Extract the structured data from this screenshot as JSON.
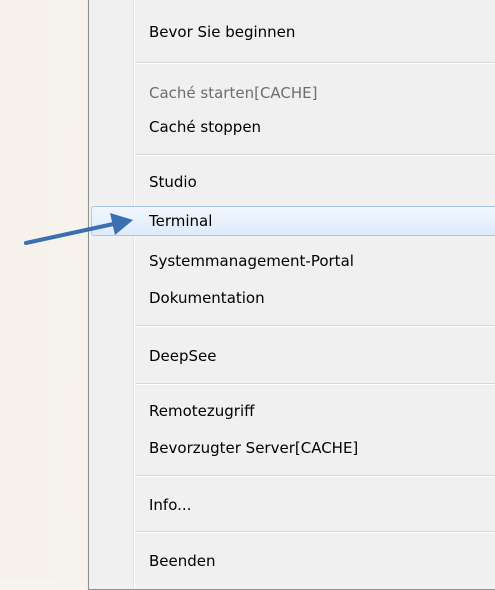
{
  "menu": {
    "items": [
      {
        "label": "Bevor Sie beginnen"
      },
      {
        "label": "Caché starten[CACHE]"
      },
      {
        "label": "Caché stoppen"
      },
      {
        "label": "Studio"
      },
      {
        "label": "Terminal"
      },
      {
        "label": "Systemmanagement-Portal"
      },
      {
        "label": "Dokumentation"
      },
      {
        "label": "DeepSee"
      },
      {
        "label": "Remotezugriff"
      },
      {
        "label": "Bevorzugter Server[CACHE]"
      },
      {
        "label": "Info..."
      },
      {
        "label": "Beenden"
      }
    ]
  },
  "annotation": {
    "color": "#3a6fb0",
    "icon": "arrow-icon"
  },
  "colors": {
    "highlight_border": "#a8c8ec",
    "menu_bg": "#f0f0f0",
    "disabled_text": "#6d6d6d"
  }
}
